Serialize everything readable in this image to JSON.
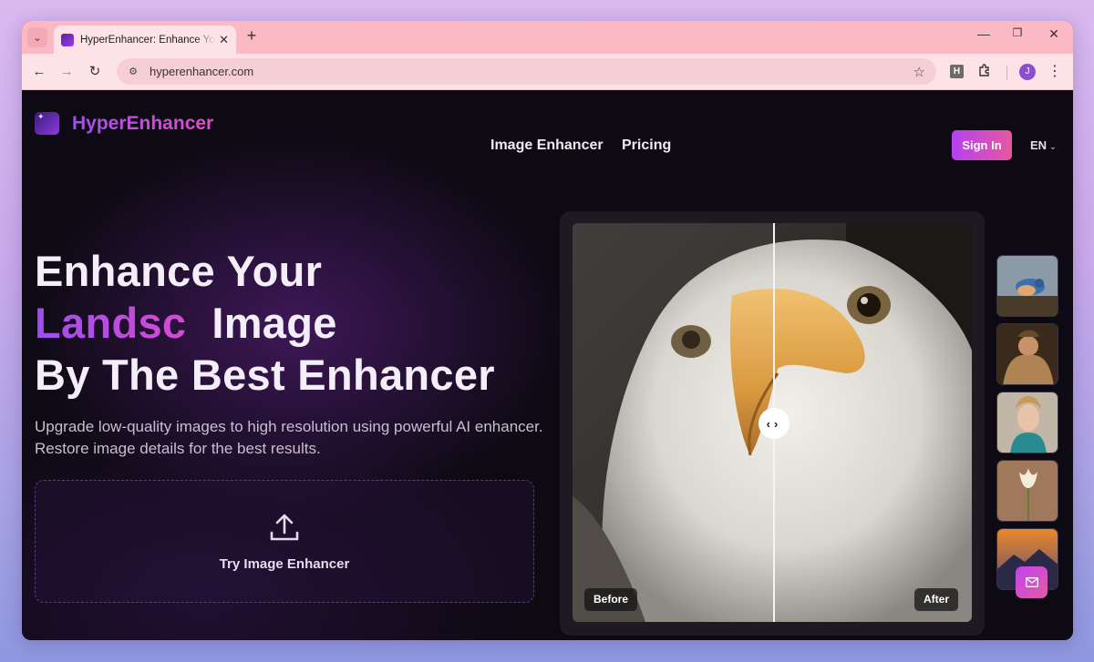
{
  "browser": {
    "tab_title": "HyperEnhancer: Enhance Your Image",
    "url": "hyperenhancer.com",
    "extension_label": "H",
    "profile_initial": "J"
  },
  "header": {
    "brand": "HyperEnhancer",
    "nav": [
      "Image Enhancer",
      "Pricing"
    ],
    "signin_label": "Sign In",
    "language": "EN"
  },
  "hero": {
    "line1": "Enhance Your",
    "typed_word": "Landsc",
    "line2_rest": "Image",
    "line3": "By The Best Enhancer",
    "subtitle": "Upgrade low-quality images to high resolution using powerful AI enhancer. Restore image details for the best results.",
    "upload_label": "Try Image Enhancer"
  },
  "compare": {
    "before_label": "Before",
    "after_label": "After",
    "split_fraction": 0.5
  },
  "thumbnails": [
    "bird-thumbnail",
    "fur-coat-portrait-thumbnail",
    "woman-portrait-thumbnail",
    "tulip-thumbnail",
    "mountain-sunset-thumbnail"
  ],
  "colors": {
    "accent_purple": "#a24ff0",
    "accent_pink": "#e04fc8",
    "browser_frame": "#fbb9c4"
  }
}
